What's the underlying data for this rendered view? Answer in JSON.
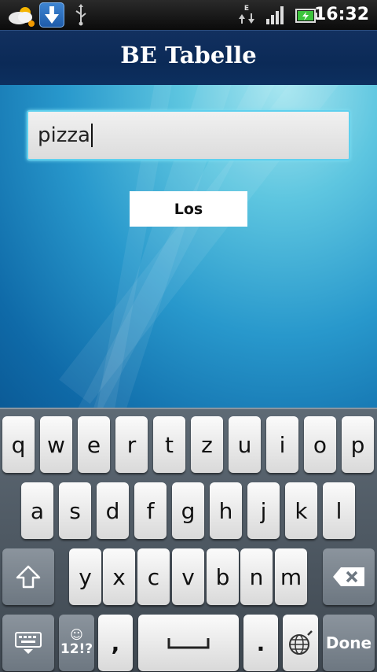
{
  "status_bar": {
    "time": "16:32",
    "icons": [
      "weather-icon",
      "download-icon",
      "usb-icon",
      "data-e-icon",
      "signal-icon",
      "battery-icon"
    ],
    "data_label": "E"
  },
  "app": {
    "title": "BE Tabelle"
  },
  "search": {
    "value": "pizza"
  },
  "actions": {
    "go_label": "Los"
  },
  "keyboard": {
    "row1": [
      "q",
      "w",
      "e",
      "r",
      "t",
      "z",
      "u",
      "i",
      "o",
      "p"
    ],
    "row2": [
      "a",
      "s",
      "d",
      "f",
      "g",
      "h",
      "j",
      "k",
      "l"
    ],
    "row3": [
      "y",
      "x",
      "c",
      "v",
      "b",
      "n",
      "m"
    ],
    "symbols_label": "12!?",
    "comma": ",",
    "period": ".",
    "done_label": "Done"
  },
  "colors": {
    "title_bar": "#0b2a57",
    "input_focus": "#5fd0ee",
    "background_top": "#a8e6f0",
    "background_bottom": "#0b5b97"
  }
}
